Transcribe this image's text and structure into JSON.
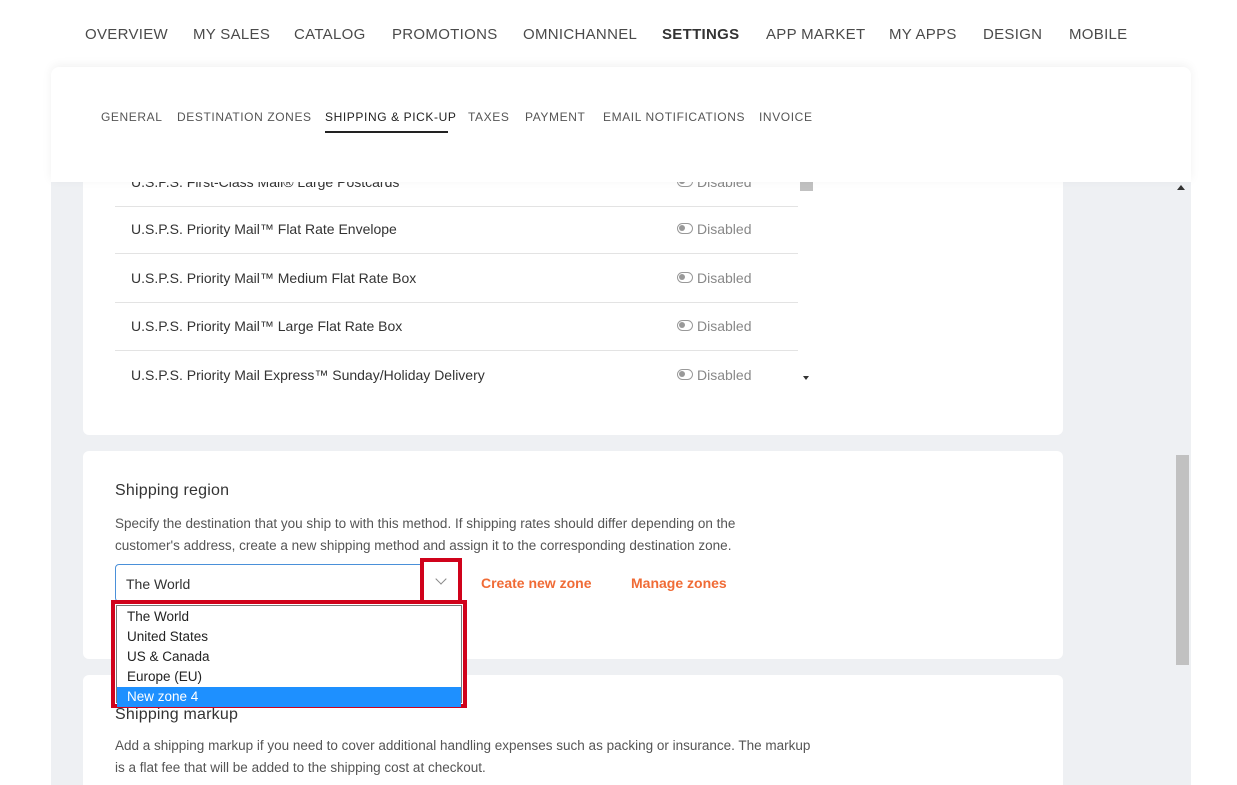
{
  "topnav": {
    "items": [
      "OVERVIEW",
      "MY SALES",
      "CATALOG",
      "PROMOTIONS",
      "OMNICHANNEL",
      "SETTINGS",
      "APP MARKET",
      "MY APPS",
      "DESIGN",
      "MOBILE"
    ],
    "active": "SETTINGS"
  },
  "subtabs": {
    "items": [
      "GENERAL",
      "DESTINATION ZONES",
      "SHIPPING & PICK-UP",
      "TAXES",
      "PAYMENT",
      "EMAIL NOTIFICATIONS",
      "INVOICE"
    ],
    "active": "SHIPPING & PICK-UP"
  },
  "methods": [
    {
      "name": "U.S.P.S. First-Class Mail® Large Postcards",
      "status": "Disabled"
    },
    {
      "name": "U.S.P.S. Priority Mail™ Flat Rate Envelope",
      "status": "Disabled"
    },
    {
      "name": "U.S.P.S. Priority Mail™ Medium Flat Rate Box",
      "status": "Disabled"
    },
    {
      "name": "U.S.P.S. Priority Mail™ Large Flat Rate Box",
      "status": "Disabled"
    },
    {
      "name": "U.S.P.S. Priority Mail Express™ Sunday/Holiday Delivery",
      "status": "Disabled"
    }
  ],
  "shipping_region": {
    "title": "Shipping region",
    "description": "Specify the destination that you ship to with this method. If shipping rates should differ depending on the customer's address, create a new shipping method and assign it to the corresponding destination zone.",
    "selected": "The World",
    "options": [
      "The World",
      "United States",
      "US & Canada",
      "Europe (EU)",
      "New zone 4"
    ],
    "highlighted_option": "New zone 4",
    "create_zone_label": "Create new zone",
    "manage_zones_label": "Manage zones"
  },
  "shipping_markup": {
    "title": "Shipping markup",
    "description": "Add a shipping markup if you need to cover additional handling expenses such as packing or insurance. The markup is a flat fee that will be added to the shipping cost at checkout."
  },
  "colors": {
    "accent_link": "#f06b36",
    "highlight_box": "#d0021b",
    "selected_option": "#1e90ff",
    "focus_border": "#4a90d9"
  }
}
